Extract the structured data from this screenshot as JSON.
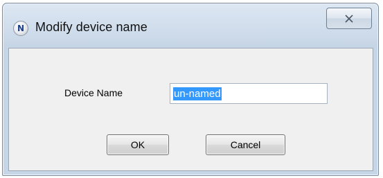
{
  "window": {
    "title": "Modify device name",
    "icon": "netgear-n-icon",
    "icon_letter": "N",
    "close_icon": "close-icon"
  },
  "form": {
    "device_name_label": "Device Name",
    "device_name_value": "un-named",
    "device_name_selected": true
  },
  "buttons": {
    "ok_label": "OK",
    "cancel_label": "Cancel"
  },
  "colors": {
    "selection": "#3399ff",
    "title_bar": "#cfdceb",
    "client_bg": "#f0f0f0"
  }
}
